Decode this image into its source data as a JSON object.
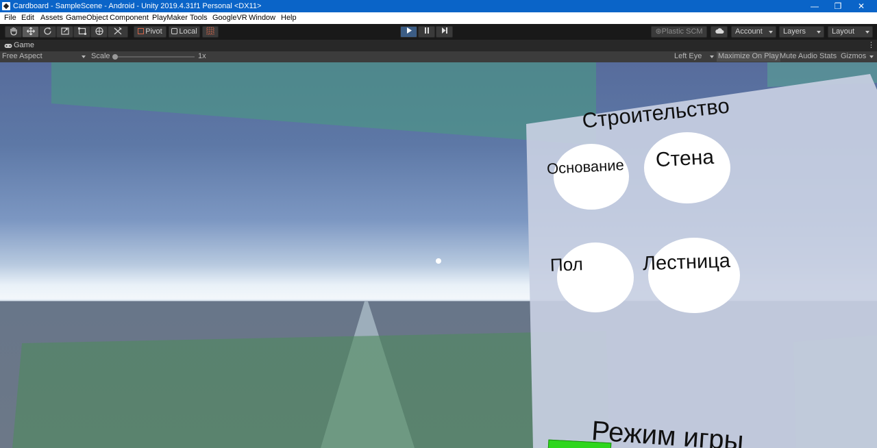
{
  "window": {
    "title": "Cardboard - SampleScene - Android - Unity 2019.4.31f1 Personal <DX11>",
    "minimize_glyph": "—",
    "maximize_glyph": "❐",
    "close_glyph": "✕"
  },
  "menu": [
    "File",
    "Edit",
    "Assets",
    "GameObject",
    "Component",
    "PlayMaker",
    "Tools",
    "GoogleVR",
    "Window",
    "Help"
  ],
  "toolbar": {
    "pivot_label": "Pivot",
    "local_label": "Local",
    "plastic_label": "Plastic SCM",
    "account_label": "Account",
    "layers_label": "Layers",
    "layout_label": "Layout",
    "play_state": "playing"
  },
  "game_tab": {
    "label": "Game",
    "aspect": "Free Aspect",
    "scale_label": "Scale",
    "scale_value": "1x",
    "eye": "Left Eye",
    "maximize_on_play": "Maximize On Play",
    "mute_audio": "Mute Audio",
    "stats": "Stats",
    "gizmos": "Gizmos"
  },
  "scene": {
    "panel_title": "Строительство",
    "buttons": [
      "Основание",
      "Стена",
      "Пол",
      "Лестница"
    ],
    "mode_title": "Режим игры",
    "colors": {
      "sky_top": "#576c9c",
      "horizon": "#f3f7fb",
      "ground": "#6c7888",
      "green_overlay": "#4f9a7a",
      "panel": "#c6cee0",
      "mode_bar": "#2ed61d"
    }
  }
}
